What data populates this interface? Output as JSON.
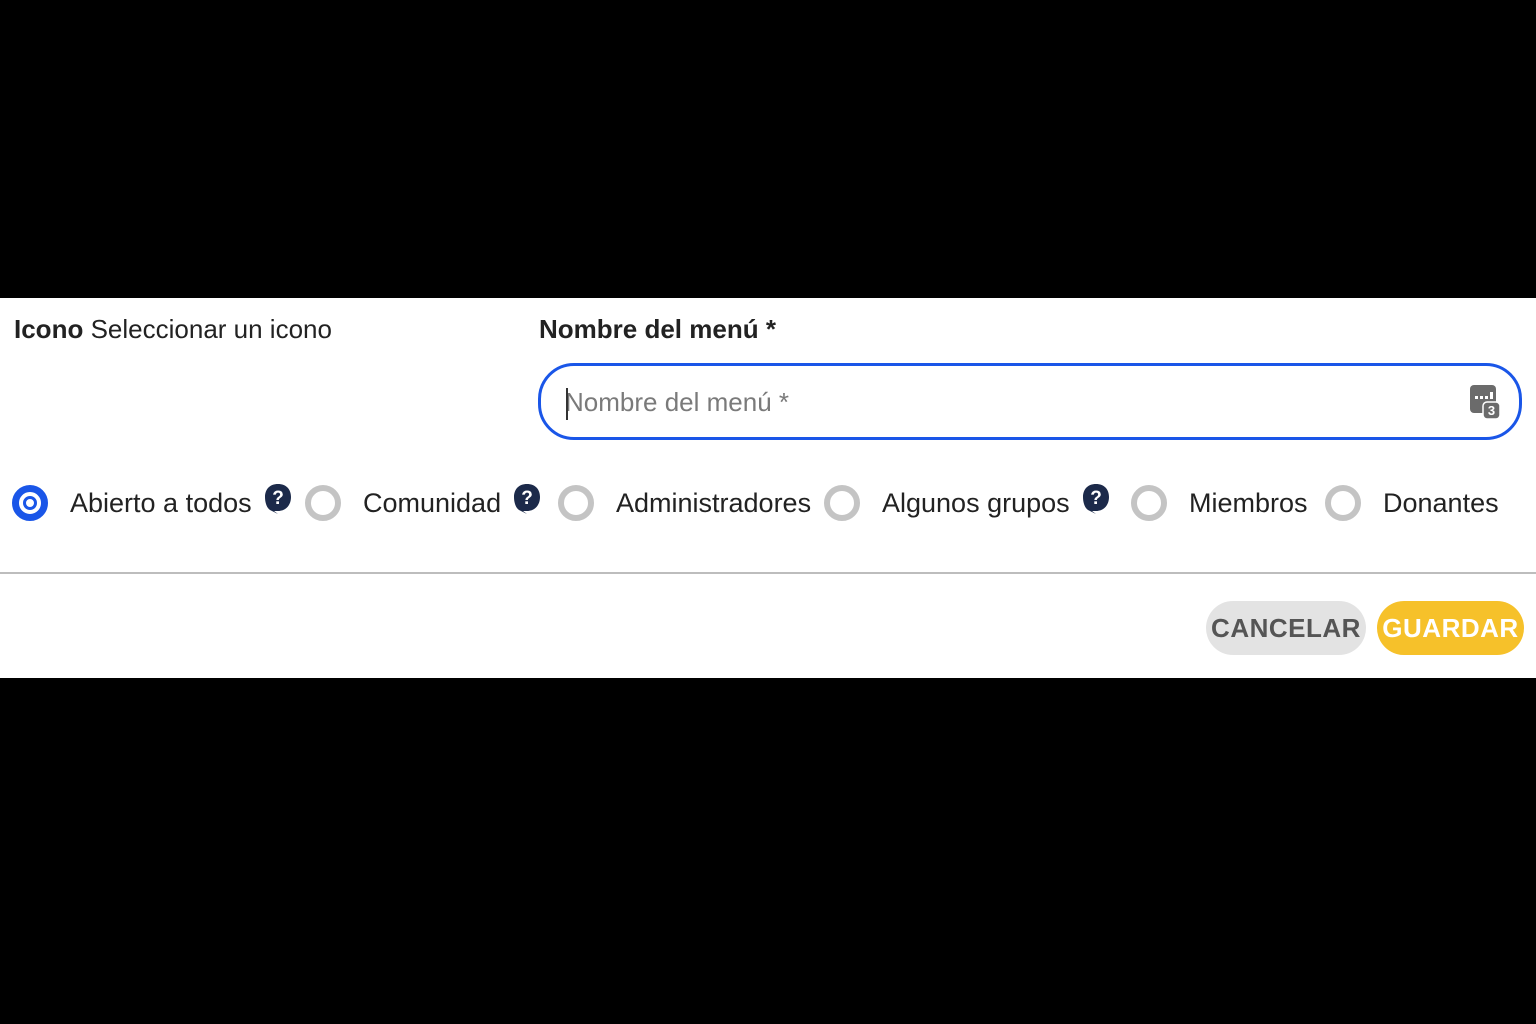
{
  "icon_field": {
    "label": "Icono",
    "select_text": "Seleccionar un icono"
  },
  "menu_name": {
    "label": "Nombre del menú *",
    "placeholder": "Nombre del menú *",
    "value": "",
    "keyboard_icon": "keyboard-icon",
    "keyboard_badge": "3"
  },
  "visibility": {
    "selected": "Abierto a todos",
    "options": [
      {
        "label": "Abierto a todos",
        "checked": true,
        "help": true
      },
      {
        "label": "Comunidad",
        "checked": false,
        "help": true
      },
      {
        "label": "Administradores",
        "checked": false,
        "help": false
      },
      {
        "label": "Algunos grupos",
        "checked": false,
        "help": true
      },
      {
        "label": "Miembros",
        "checked": false,
        "help": false
      },
      {
        "label": "Donantes",
        "checked": false,
        "help": false
      }
    ]
  },
  "actions": {
    "cancel_label": "CANCELAR",
    "save_label": "GUARDAR"
  },
  "colors": {
    "accent_blue": "#1a56e8",
    "save_yellow": "#f6c12a",
    "cancel_gray": "#e3e3e3",
    "help_navy": "#1c2a4a"
  }
}
